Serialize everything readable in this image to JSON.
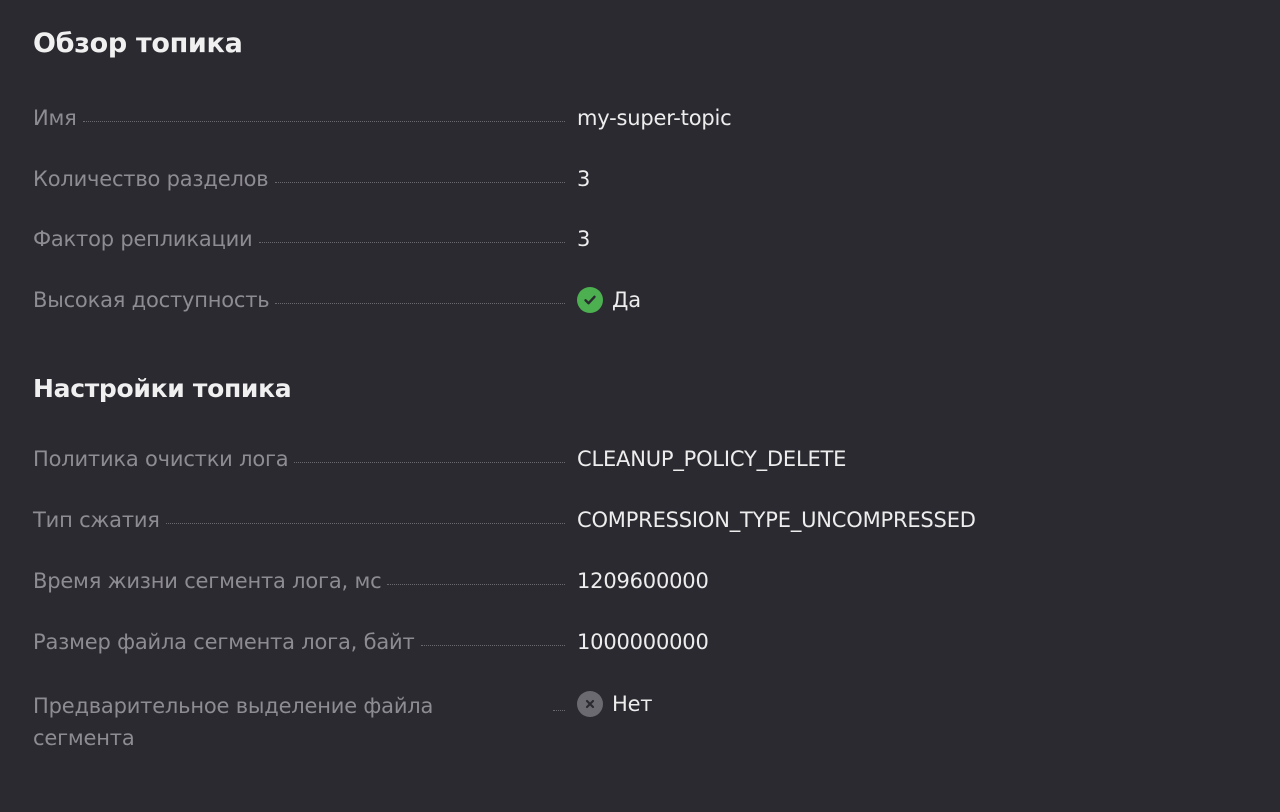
{
  "overview": {
    "title": "Обзор топика",
    "rows": [
      {
        "label": "Имя",
        "value": "my-super-topic"
      },
      {
        "label": "Количество разделов",
        "value": "3"
      },
      {
        "label": "Фактор репликации",
        "value": "3"
      },
      {
        "label": "Высокая доступность",
        "value": "Да",
        "icon": "check-circle-icon",
        "icon_color": "#4caf50"
      }
    ]
  },
  "settings": {
    "title": "Настройки топика",
    "rows": [
      {
        "label": "Политика очистки лога",
        "value": "CLEANUP_POLICY_DELETE"
      },
      {
        "label": "Тип сжатия",
        "value": "COMPRESSION_TYPE_UNCOMPRESSED"
      },
      {
        "label": "Время жизни сегмента лога, мс",
        "value": "1209600000"
      },
      {
        "label": "Размер файла сегмента лога, байт",
        "value": "1000000000"
      },
      {
        "label": "Предварительное выделение файла сегмента",
        "value": "Нет",
        "icon": "x-circle-icon",
        "icon_color": "#6b6a70"
      }
    ]
  }
}
